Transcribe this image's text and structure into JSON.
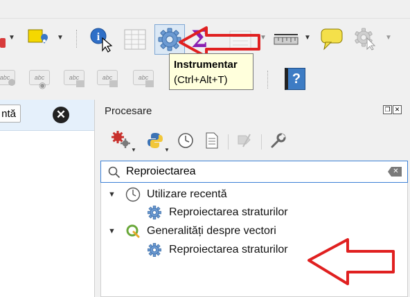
{
  "tooltip": {
    "title": "Instrumentar",
    "shortcut": "(Ctrl+Alt+T)"
  },
  "toolbar1": {
    "icons": [
      "remove-layer-icon",
      "select-feature-icon",
      "identify-icon",
      "attribute-table-icon",
      "toolbox-gear-icon",
      "statistics-sigma-icon",
      "field-calculator-icon",
      "measure-icon",
      "map-tips-icon",
      "run-process-icon"
    ]
  },
  "toolbar2": {
    "icons": [
      "label-abc-icons",
      "help-book-icon"
    ],
    "label_text": "abc",
    "help_glyph": "?"
  },
  "left_panel": {
    "button_label": "ntă"
  },
  "processing_panel": {
    "title": "Procesare",
    "search": {
      "value": "Reproiectarea",
      "placeholder": ""
    },
    "tree": {
      "groups": [
        {
          "label": "Utilizare recentă",
          "icon": "clock-icon",
          "items": [
            {
              "label": "Reproiectarea straturilor",
              "icon": "gear-icon"
            }
          ]
        },
        {
          "label": "Generalități despre vectori",
          "icon": "qgis-icon",
          "items": [
            {
              "label": "Reproiectarea straturilor",
              "icon": "gear-icon"
            }
          ]
        }
      ]
    }
  },
  "colors": {
    "annotation_arrow": "#e02020",
    "selection_blue": "#3a7fd5",
    "tooltip_bg": "#ffffdc",
    "left_highlight": "#e5f0fb"
  }
}
